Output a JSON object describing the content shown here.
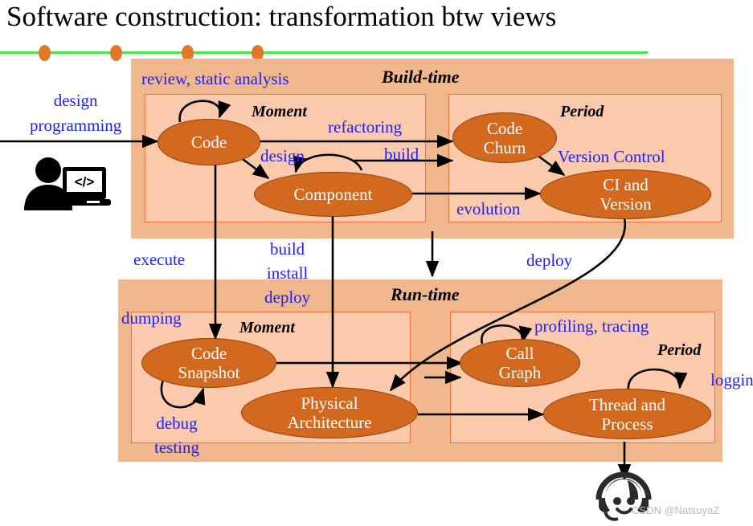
{
  "slide": {
    "title": "Software construction: transformation btw views",
    "watermark": "CSDN @NatsuyaZ"
  },
  "decor": {
    "rule_color": "#4BE24B",
    "dot_color": "#E2772A",
    "dot_count": 4
  },
  "palette": {
    "outer_panel": "#F0B78C",
    "inner_panel": "#FBC9AC",
    "inner_border": "#E8763C",
    "node_fill": "#D2691E",
    "node_text": "#FFFFFF",
    "label_blue": "#2222EE",
    "arrow": "#000000",
    "title_text": "#000000",
    "watermark_text": "#B9B9B9"
  },
  "phases": [
    {
      "id": "build-time",
      "title": "Build-time",
      "panels": [
        {
          "id": "build-moment",
          "title": "Moment"
        },
        {
          "id": "build-period",
          "title": "Period"
        }
      ]
    },
    {
      "id": "run-time",
      "title": "Run-time",
      "panels": [
        {
          "id": "run-moment",
          "title": "Moment"
        },
        {
          "id": "run-period",
          "title": "Period"
        }
      ]
    }
  ],
  "nodes": [
    {
      "id": "code",
      "label": "Code"
    },
    {
      "id": "component",
      "label": "Component"
    },
    {
      "id": "code-churn",
      "label": "Code\nChurn"
    },
    {
      "id": "ci-and-version",
      "label": "CI and\nVersion"
    },
    {
      "id": "code-snapshot",
      "label": "Code\nSnapshot"
    },
    {
      "id": "physical-architecture",
      "label": "Physical\nArchitecture"
    },
    {
      "id": "call-graph",
      "label": "Call\nGraph"
    },
    {
      "id": "thread-and-process",
      "label": "Thread and\nProcess"
    }
  ],
  "edge_labels": [
    {
      "id": "design-programming",
      "text": "design\nprogramming"
    },
    {
      "id": "review-static-analysis",
      "text": "review, static analysis"
    },
    {
      "id": "refactoring",
      "text": "refactoring"
    },
    {
      "id": "design",
      "text": "design"
    },
    {
      "id": "build",
      "text": "build"
    },
    {
      "id": "version-control",
      "text": "Version Control"
    },
    {
      "id": "evolution",
      "text": "evolution"
    },
    {
      "id": "execute",
      "text": "execute"
    },
    {
      "id": "build-install-deploy",
      "text": "build\ninstall\ndeploy"
    },
    {
      "id": "deploy",
      "text": "deploy"
    },
    {
      "id": "dumping",
      "text": "dumping"
    },
    {
      "id": "debug-testing",
      "text": "debug\ntesting"
    },
    {
      "id": "profiling-tracing",
      "text": "profiling, tracing"
    },
    {
      "id": "logging",
      "text": "logging"
    }
  ],
  "icons": [
    {
      "id": "developer-icon",
      "glyph": "</>",
      "meaning": "developer writing code at a laptop"
    },
    {
      "id": "end-user-icon",
      "glyph": "",
      "meaning": "end user with headset"
    }
  ]
}
